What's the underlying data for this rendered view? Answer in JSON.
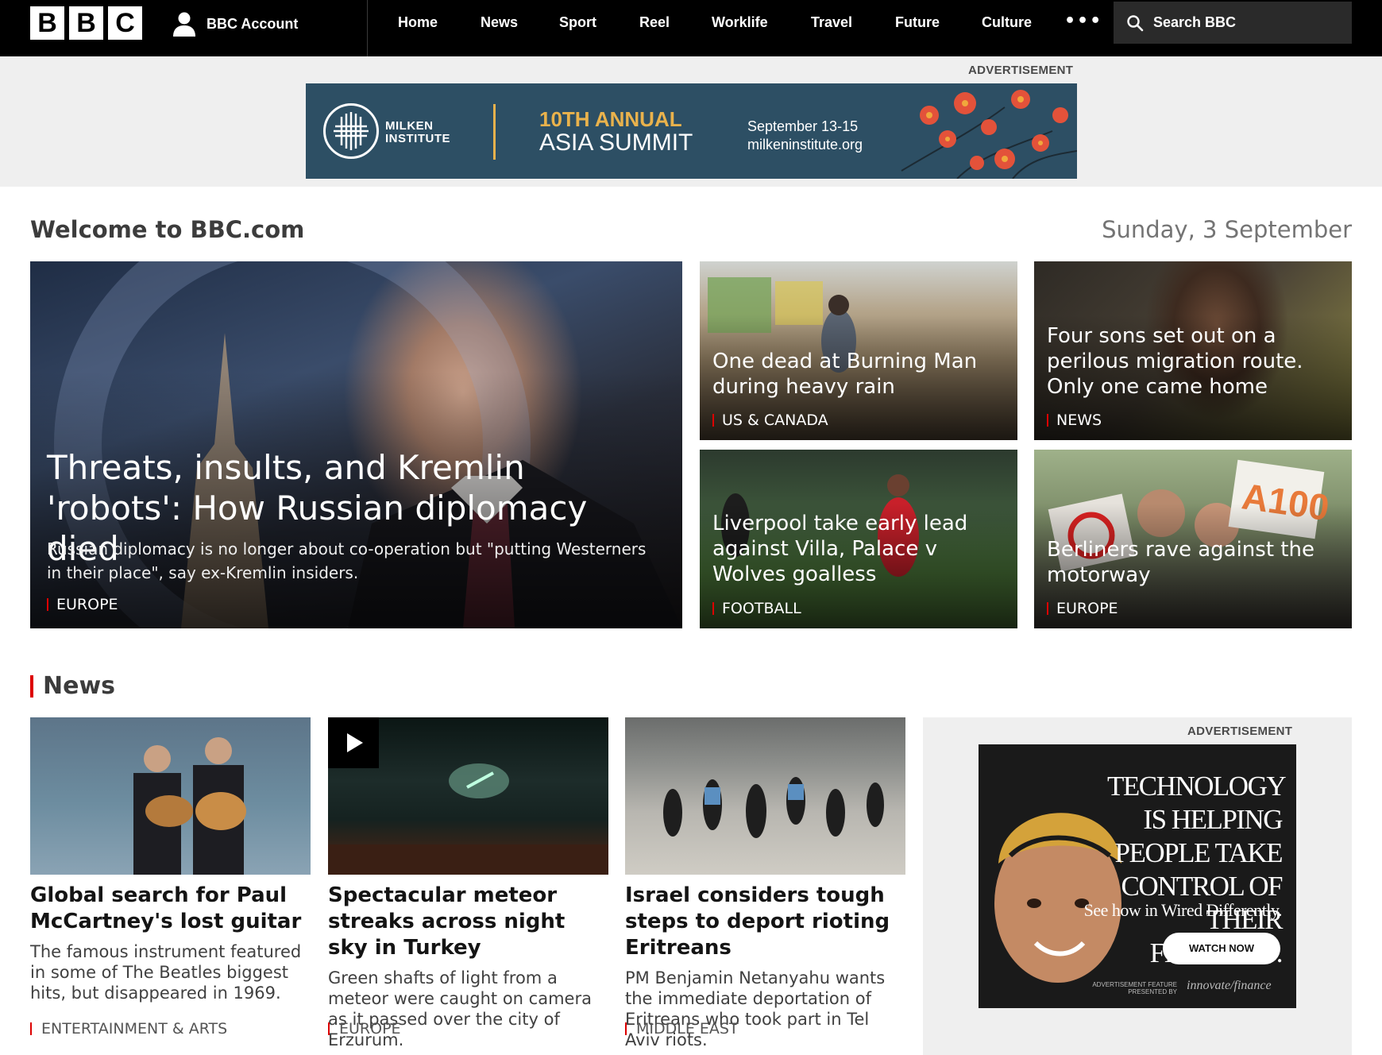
{
  "nav": {
    "logo": [
      "B",
      "B",
      "C"
    ],
    "account_label": "BBC Account",
    "items": [
      "Home",
      "News",
      "Sport",
      "Reel",
      "Worklife",
      "Travel",
      "Future",
      "Culture"
    ],
    "more_label": "•••",
    "search_label": "Search BBC"
  },
  "top_ad": {
    "label": "ADVERTISEMENT",
    "logo_text": "MILKEN INSTITUTE",
    "headline_1": "10TH ANNUAL",
    "headline_2": "ASIA SUMMIT",
    "dates": "September 13-15",
    "url": "milkeninstitute.org",
    "colors": {
      "background": "#2d4f64",
      "accent": "#e9b24c",
      "flowers": "#e3523a"
    }
  },
  "welcome": {
    "title": "Welcome to BBC.com",
    "date": "Sunday, 3 September"
  },
  "featured": [
    {
      "title": "Threats, insults, and Kremlin 'robots': How Russian diplomacy died",
      "summary": "Russian diplomacy is no longer about co-operation but \"putting Westerners in their place\", say ex-Kremlin insiders.",
      "tag": "EUROPE"
    },
    {
      "title": "One dead at Burning Man during heavy rain",
      "tag": "US & CANADA"
    },
    {
      "title": "Four sons set out on a perilous migration route. Only one came home",
      "tag": "NEWS"
    },
    {
      "title": "Liverpool take early lead against Villa, Palace v Wolves goalless",
      "tag": "FOOTBALL"
    },
    {
      "title": "Berliners rave against the motorway",
      "tag": "EUROPE"
    }
  ],
  "news": {
    "heading": "News",
    "items": [
      {
        "headline": "Global search for Paul McCartney's lost guitar",
        "description": "The famous instrument featured in some of The Beatles biggest hits, but disappeared in 1969.",
        "tag": "ENTERTAINMENT & ARTS"
      },
      {
        "headline": "Spectacular meteor streaks across night sky in Turkey",
        "description": "Green shafts of light from a meteor were caught on camera as it passed over the city of Erzurum.",
        "tag": "EUROPE",
        "is_video": true
      },
      {
        "headline": "Israel considers tough steps to deport rioting Eritreans",
        "description": "PM Benjamin Netanyahu wants the immediate deportation of Eritreans who took part in Tel Aviv riots.",
        "tag": "MIDDLE EAST"
      }
    ]
  },
  "side_ad": {
    "label": "ADVERTISEMENT",
    "headline": "TECHNOLOGY IS HELPING PEOPLE TAKE CONTROL OF THEIR FINANCES.",
    "subline": "See how in Wired Differently.",
    "button": "WATCH NOW",
    "feature_note": "ADVERTISEMENT FEATURE PRESENTED BY",
    "brand": "innovate/finance"
  },
  "colors": {
    "accent_red": "#d00000",
    "nav_bg": "#000000",
    "ad_band_bg": "#efefef"
  }
}
